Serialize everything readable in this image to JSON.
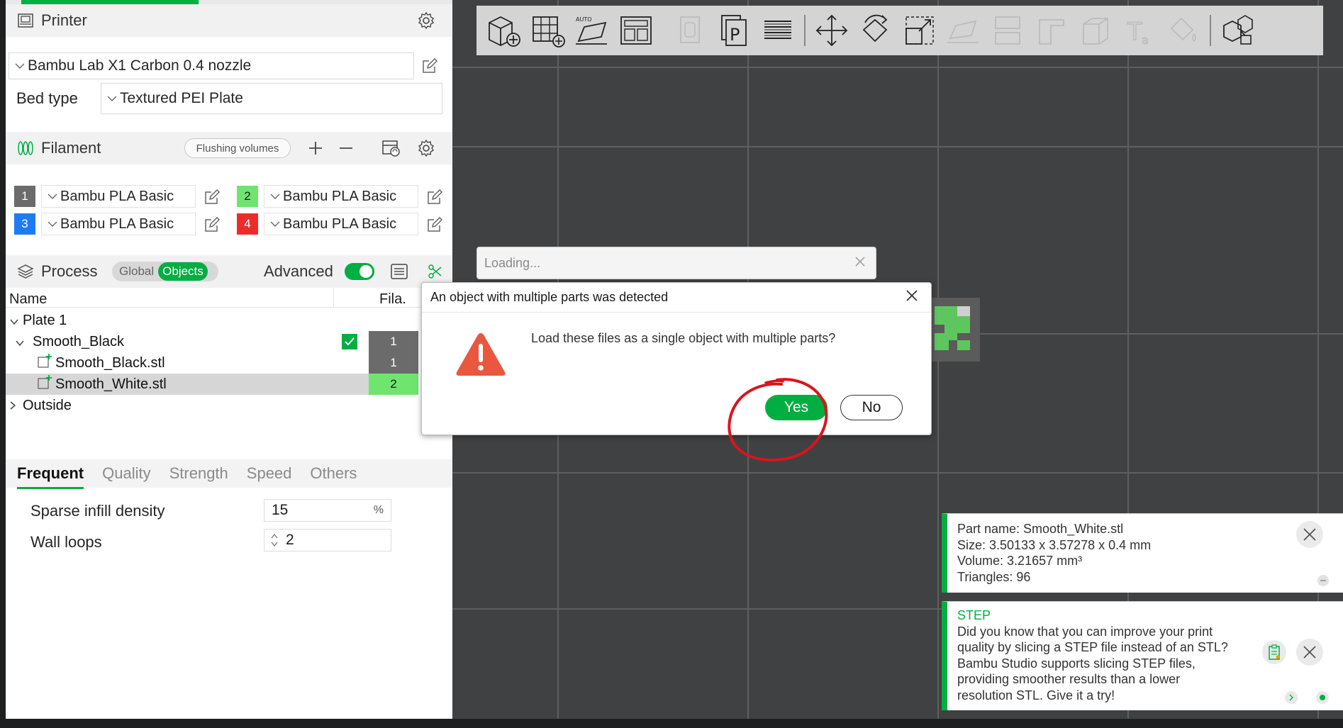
{
  "printer": {
    "section_label": "Printer",
    "preset": "Bambu Lab X1 Carbon 0.4 nozzle",
    "bed_type_label": "Bed type",
    "bed_type_value": "Textured PEI Plate"
  },
  "filament": {
    "section_label": "Filament",
    "flushing_label": "Flushing volumes",
    "slots": [
      {
        "num": "1",
        "name": "Bambu PLA Basic",
        "color": "#6b6b6b"
      },
      {
        "num": "2",
        "name": "Bambu PLA Basic",
        "color": "#6fe56f"
      },
      {
        "num": "3",
        "name": "Bambu PLA Basic",
        "color": "#1f7bf2"
      },
      {
        "num": "4",
        "name": "Bambu PLA Basic",
        "color": "#ee2b2b"
      }
    ]
  },
  "process": {
    "section_label": "Process",
    "global_label": "Global",
    "objects_label": "Objects",
    "advanced_label": "Advanced"
  },
  "object_list": {
    "col_name": "Name",
    "col_fila": "Fila.",
    "rows": [
      {
        "label": "Plate 1"
      },
      {
        "label": "Smooth_Black",
        "fila": "1"
      },
      {
        "label": "Smooth_Black.stl",
        "fila": "1"
      },
      {
        "label": "Smooth_White.stl",
        "fila": "2"
      },
      {
        "label": "Outside"
      }
    ]
  },
  "settings": {
    "tabs": [
      "Frequent",
      "Quality",
      "Strength",
      "Speed",
      "Others"
    ],
    "sparse_label": "Sparse infill density",
    "sparse_value": "15",
    "sparse_unit": "%",
    "wall_label": "Wall loops",
    "wall_value": "2"
  },
  "loading_dialog": {
    "title": "Loading..."
  },
  "dialog": {
    "title": "An object with multiple parts was detected",
    "message": "Load these files as a single object with multiple parts?",
    "yes": "Yes",
    "no": "No"
  },
  "part_info": {
    "name": "Part name: Smooth_White.stl",
    "size": "Size: 3.50133 x 3.57278 x 0.4 mm",
    "volume": "Volume: 3.21657 mm³",
    "triangles": "Triangles: 96"
  },
  "step_notice": {
    "title": "STEP",
    "line1": "Did you know that you can improve your print",
    "line2": "quality by slicing a STEP file instead of an STL?",
    "line3": "Bambu Studio supports slicing STEP files,",
    "line4": "providing smoother results than a lower",
    "line5": "resolution STL. Give it a try!"
  },
  "colors": {
    "accent": "#00ae42",
    "annotation": "#d9141e"
  }
}
